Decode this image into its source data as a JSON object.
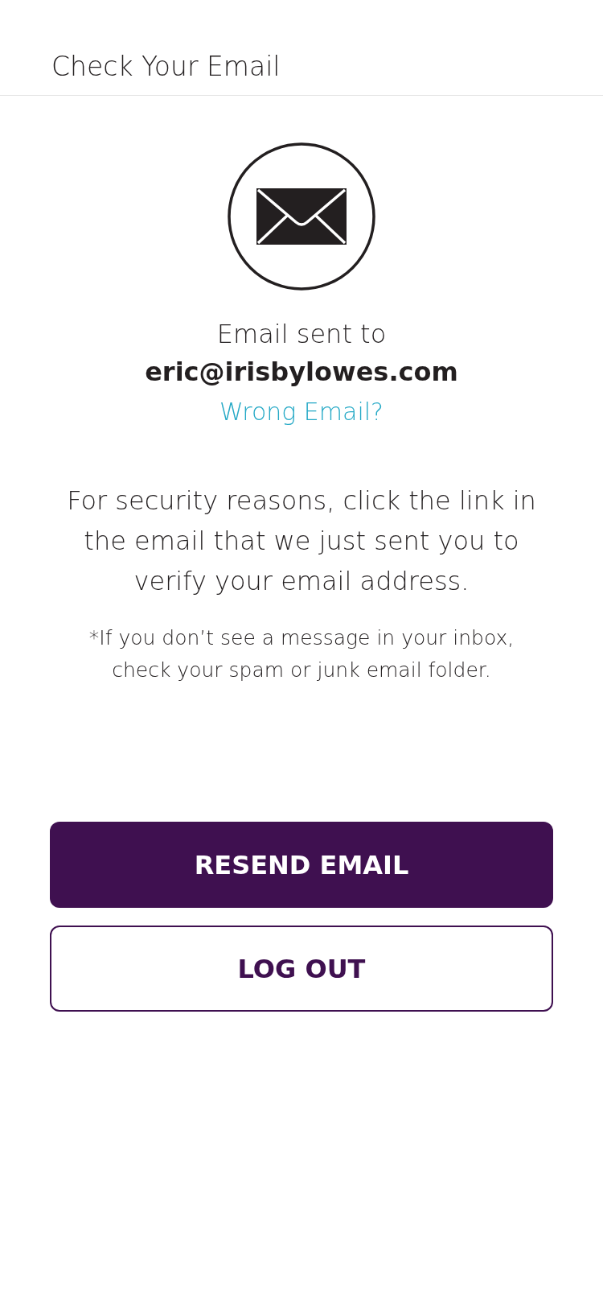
{
  "header": {
    "title": "Check Your Email"
  },
  "message": {
    "sent_label": "Email sent to",
    "email": "eric@irisbylowes.com",
    "wrong_email_link": "Wrong Email?"
  },
  "instructions": "For security reasons, click the link in the email that we just sent you to verify your email address.",
  "note": "*If you don’t see a message in your inbox, check your spam or junk email folder.",
  "buttons": [
    {
      "label": "RESEND EMAIL",
      "kind": "primary"
    },
    {
      "label": "LOG OUT",
      "kind": "secondary"
    }
  ]
}
